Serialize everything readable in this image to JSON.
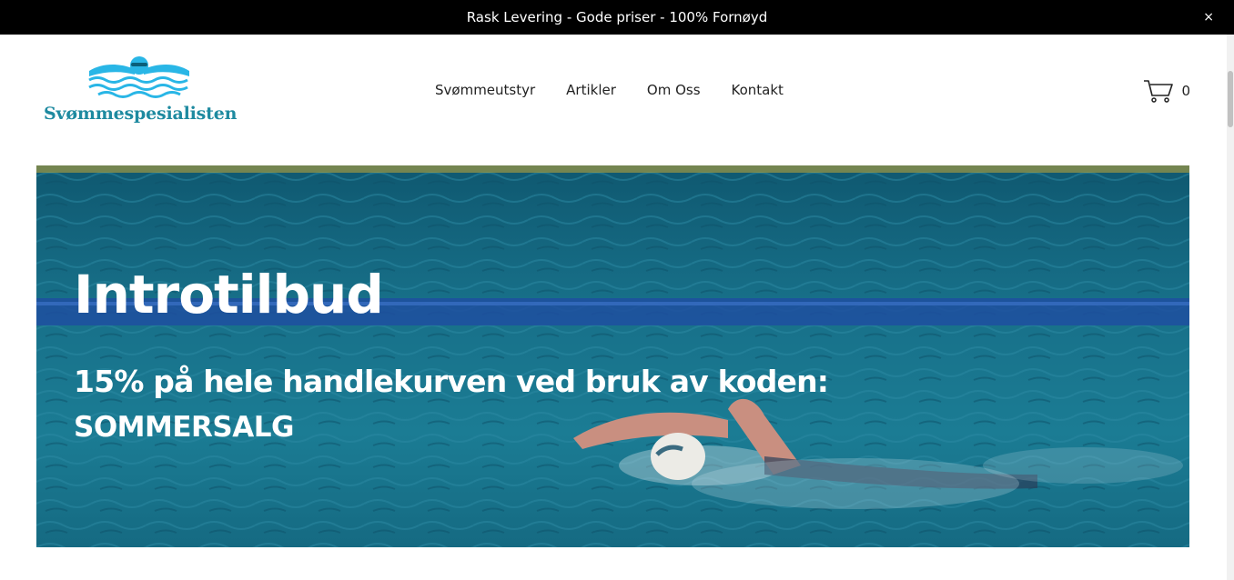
{
  "announcement": {
    "text": "Rask Levering - Gode priser - 100% Fornøyd",
    "close_label": "×"
  },
  "logo": {
    "text": "Svømmespesialisten",
    "color": "#1e8aa0",
    "accent": "#29b6e6"
  },
  "nav": {
    "items": [
      "Svømmeutstyr",
      "Artikler",
      "Om Oss",
      "Kontakt"
    ]
  },
  "cart": {
    "icon": "cart-icon",
    "count": "0"
  },
  "hero": {
    "title": "Introtilbud",
    "subtitle": "15% på hele handlekurven ved bruk av koden:",
    "code": "SOMMERSALG"
  }
}
